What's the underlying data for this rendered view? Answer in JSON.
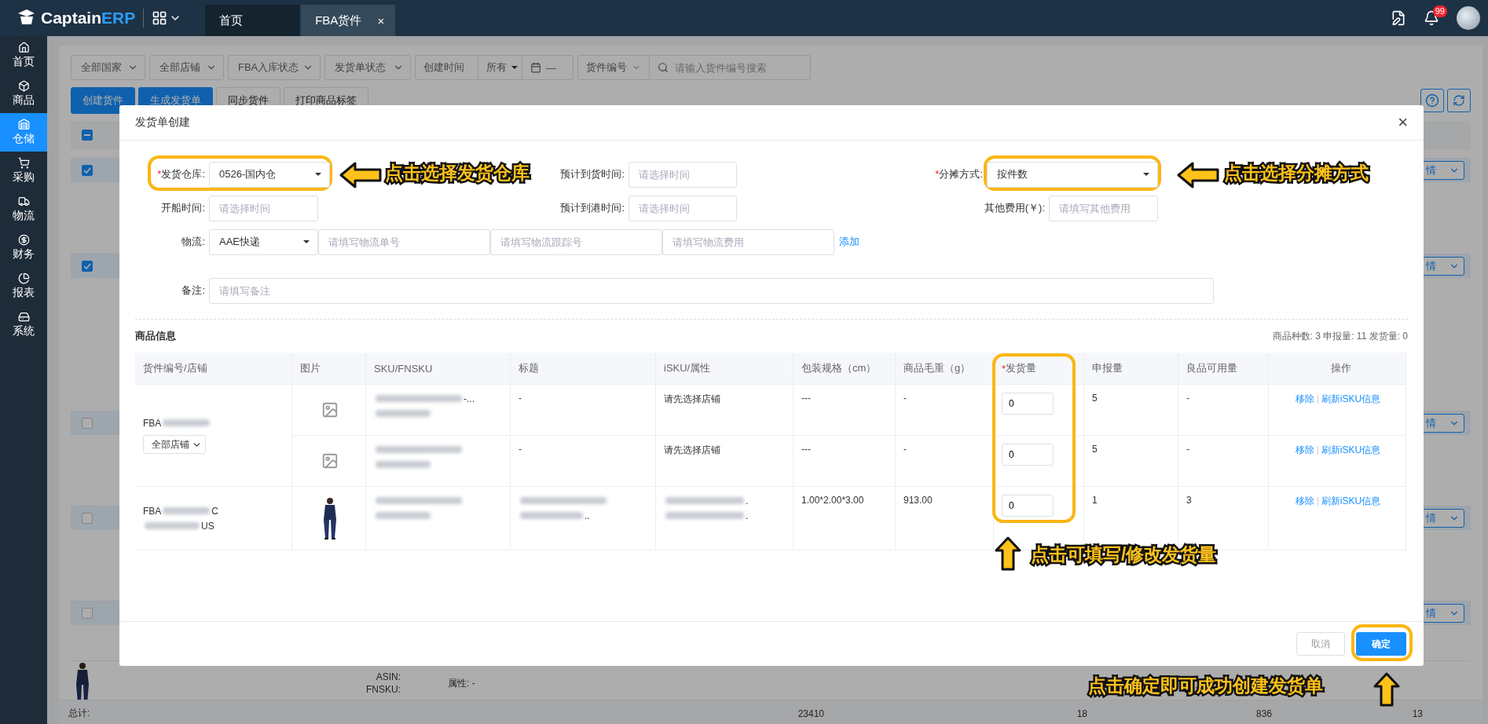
{
  "topbar": {
    "logo": {
      "name": "Captain",
      "accent": "ERP"
    },
    "tabs": [
      {
        "label": "首页",
        "selected": false,
        "closable": false
      },
      {
        "label": "FBA货件",
        "selected": true,
        "closable": true
      }
    ],
    "tab_close": "×",
    "notification_badge": "99"
  },
  "sidebar": {
    "items": [
      {
        "label": "首页",
        "selected": false
      },
      {
        "label": "商品",
        "selected": false
      },
      {
        "label": "仓储",
        "selected": true
      },
      {
        "label": "采购",
        "selected": false
      },
      {
        "label": "物流",
        "selected": false
      },
      {
        "label": "财务",
        "selected": false
      },
      {
        "label": "报表",
        "selected": false
      },
      {
        "label": "系统",
        "selected": false
      }
    ]
  },
  "filters": {
    "selects": [
      "全部国家",
      "全部店铺",
      "FBA入库状态",
      "发货单状态"
    ],
    "date_label": "创建时间",
    "date_range": "所有",
    "date_separator": "—",
    "search_field": "货件编号",
    "search_placeholder": "请输入货件编号搜索"
  },
  "actions": [
    {
      "label": "创建货件",
      "primary": true
    },
    {
      "label": "生成发货单",
      "primary": true
    },
    {
      "label": "同步货件",
      "primary": false
    },
    {
      "label": "打印商品标签",
      "primary": false
    }
  ],
  "list": {
    "header_checkbox": {
      "indeterminate": true
    },
    "groups": [
      {
        "checked": true,
        "detail": "情"
      },
      {
        "checked": true,
        "detail": "情"
      },
      {
        "checked": false,
        "detail": "情"
      },
      {
        "checked": false,
        "detail": "情"
      },
      {
        "checked": false,
        "detail": "情"
      }
    ],
    "last_row": {
      "asin_label": "ASIN:",
      "fnsku_label": "FNSKU:",
      "attribute": "属性: -"
    },
    "totals": {
      "label": "总计:",
      "values": [
        "23410",
        "18",
        "836",
        "13"
      ]
    }
  },
  "modal": {
    "title": "发货单创建",
    "close": "×",
    "required_mark": "*",
    "warehouse": {
      "label": "发货仓库:",
      "required": true,
      "value": "0526-国内仓"
    },
    "arrival_time": {
      "label": "预计到货时间:",
      "placeholder": "请选择时间"
    },
    "allocation": {
      "label": "分摊方式:",
      "required": true,
      "value": "按件数"
    },
    "sailing_time": {
      "label": "开船时间:",
      "placeholder": "请选择时间"
    },
    "port_time": {
      "label": "预计到港时间:",
      "placeholder": "请选择时间"
    },
    "other_fee": {
      "label": "其他费用(￥):",
      "placeholder": "请填写其他费用"
    },
    "logistics": {
      "label": "物流:",
      "value": "AAE快递",
      "placeholders": [
        "请填写物流单号",
        "请填写物流跟踪号",
        "请填写物流费用"
      ],
      "add": "添加"
    },
    "remark": {
      "label": "备注:",
      "placeholder": "请填写备注"
    },
    "section_title": "商品信息",
    "summary": [
      {
        "label": "商品种数:",
        "value": "3"
      },
      {
        "label": "申报量:",
        "value": "11"
      },
      {
        "label": "发货量:",
        "value": "0"
      }
    ],
    "columns": [
      {
        "label": "货件编号/店铺",
        "required": false
      },
      {
        "label": "图片",
        "required": false
      },
      {
        "label": "SKU/FNSKU",
        "required": false
      },
      {
        "label": "标题",
        "required": false
      },
      {
        "label": "iSKU/属性",
        "required": false
      },
      {
        "label": "包装规格（cm）",
        "required": false
      },
      {
        "label": "商品毛重（g）",
        "required": false
      },
      {
        "label": "发货量",
        "required": true
      },
      {
        "label": "申报量",
        "required": false
      },
      {
        "label": "良品可用量",
        "required": false
      },
      {
        "label": "操作",
        "required": false
      }
    ],
    "shipments": [
      {
        "id_prefix": "FBA",
        "store_select": "全部店铺",
        "items": [
          {
            "kind": "placeholder",
            "sku_tail": "-...",
            "title": "-",
            "isku": "请先选择店铺",
            "package": "---",
            "weight": "-",
            "quantity": "0",
            "declared": "5",
            "available": "-",
            "actions": [
              "移除",
              "刷新iSKU信息"
            ]
          },
          {
            "kind": "placeholder",
            "title": "-",
            "isku": "请先选择店铺",
            "package": "---",
            "weight": "-",
            "quantity": "0",
            "declared": "5",
            "available": "-",
            "actions": [
              "移除",
              "刷新iSKU信息"
            ]
          }
        ]
      },
      {
        "id_prefix": "FBA",
        "id_suffix": "C",
        "store_suffix": "US",
        "items": [
          {
            "kind": "picture",
            "title_tail": "..",
            "isku_tails": [
              ".",
              "."
            ],
            "package": "1.00*2.00*3.00",
            "weight": "913.00",
            "quantity": "0",
            "declared": "1",
            "available": "3",
            "actions": [
              "移除",
              "刷新iSKU信息"
            ]
          }
        ]
      }
    ],
    "cancel": "取消",
    "confirm": "确定"
  },
  "annotations": [
    {
      "text": "点击选择发货仓库"
    },
    {
      "text": "点击选择分摊方式"
    },
    {
      "text": "点击可填写/修改发货量"
    },
    {
      "text": "点击确定即可成功创建发货单"
    }
  ]
}
